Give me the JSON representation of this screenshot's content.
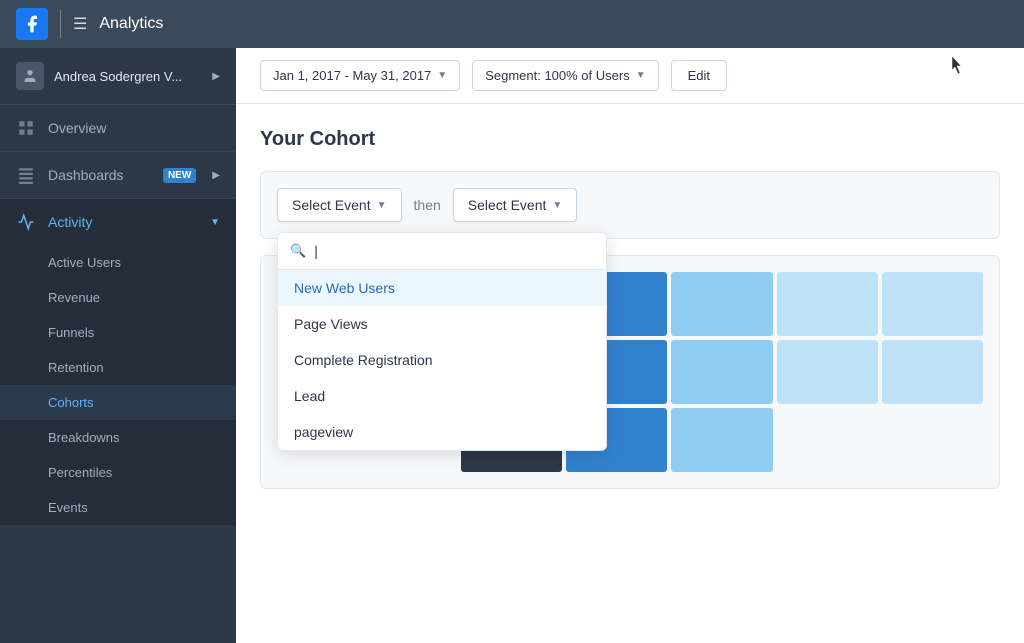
{
  "topbar": {
    "fb_icon": "f",
    "hamburger": "☰",
    "title": "Analytics"
  },
  "sidebar": {
    "user": {
      "name": "Andrea Sodergren V...",
      "chevron": "▶"
    },
    "nav_items": [
      {
        "id": "overview",
        "label": "Overview",
        "icon": "chart"
      },
      {
        "id": "dashboards",
        "label": "Dashboards",
        "badge": "NEW",
        "icon": "grid"
      }
    ],
    "activity": {
      "label": "Activity",
      "sub_items": [
        {
          "id": "active-users",
          "label": "Active Users",
          "active": false
        },
        {
          "id": "revenue",
          "label": "Revenue",
          "active": false
        },
        {
          "id": "funnels",
          "label": "Funnels",
          "active": false
        },
        {
          "id": "retention",
          "label": "Retention",
          "active": false
        },
        {
          "id": "cohorts",
          "label": "Cohorts",
          "active": true
        },
        {
          "id": "breakdowns",
          "label": "Breakdowns",
          "active": false
        },
        {
          "id": "percentiles",
          "label": "Percentiles",
          "active": false
        },
        {
          "id": "events",
          "label": "Events",
          "active": false
        }
      ]
    }
  },
  "header": {
    "date_range": "Jan 1, 2017 - May 31, 2017",
    "segment": "Segment: 100% of Users",
    "edit": "Edit"
  },
  "page": {
    "title": "Your Cohort",
    "filter": {
      "select_event_1": "Select Event",
      "then_label": "then",
      "select_event_2": "Select Event"
    },
    "dropdown": {
      "search_placeholder": "",
      "items": [
        {
          "id": "new-web-users",
          "label": "New Web Users",
          "highlighted": true
        },
        {
          "id": "page-views",
          "label": "Page Views",
          "highlighted": false
        },
        {
          "id": "complete-registration",
          "label": "Complete Registration",
          "highlighted": false
        },
        {
          "id": "lead",
          "label": "Lead",
          "highlighted": false
        },
        {
          "id": "pageview",
          "label": "pageview",
          "highlighted": false
        }
      ]
    },
    "cohort_grid": {
      "rows": [
        {
          "cells": [
            "dark",
            "blue-med",
            "blue-light",
            "blue-lighter",
            "blue-lighter"
          ]
        },
        {
          "cells": [
            "blue-med",
            "blue-med",
            "blue-light",
            "blue-lighter",
            "blue-lighter"
          ]
        },
        {
          "cells": [
            "dark",
            "blue-med",
            "blue-light",
            "",
            ""
          ]
        }
      ]
    }
  }
}
